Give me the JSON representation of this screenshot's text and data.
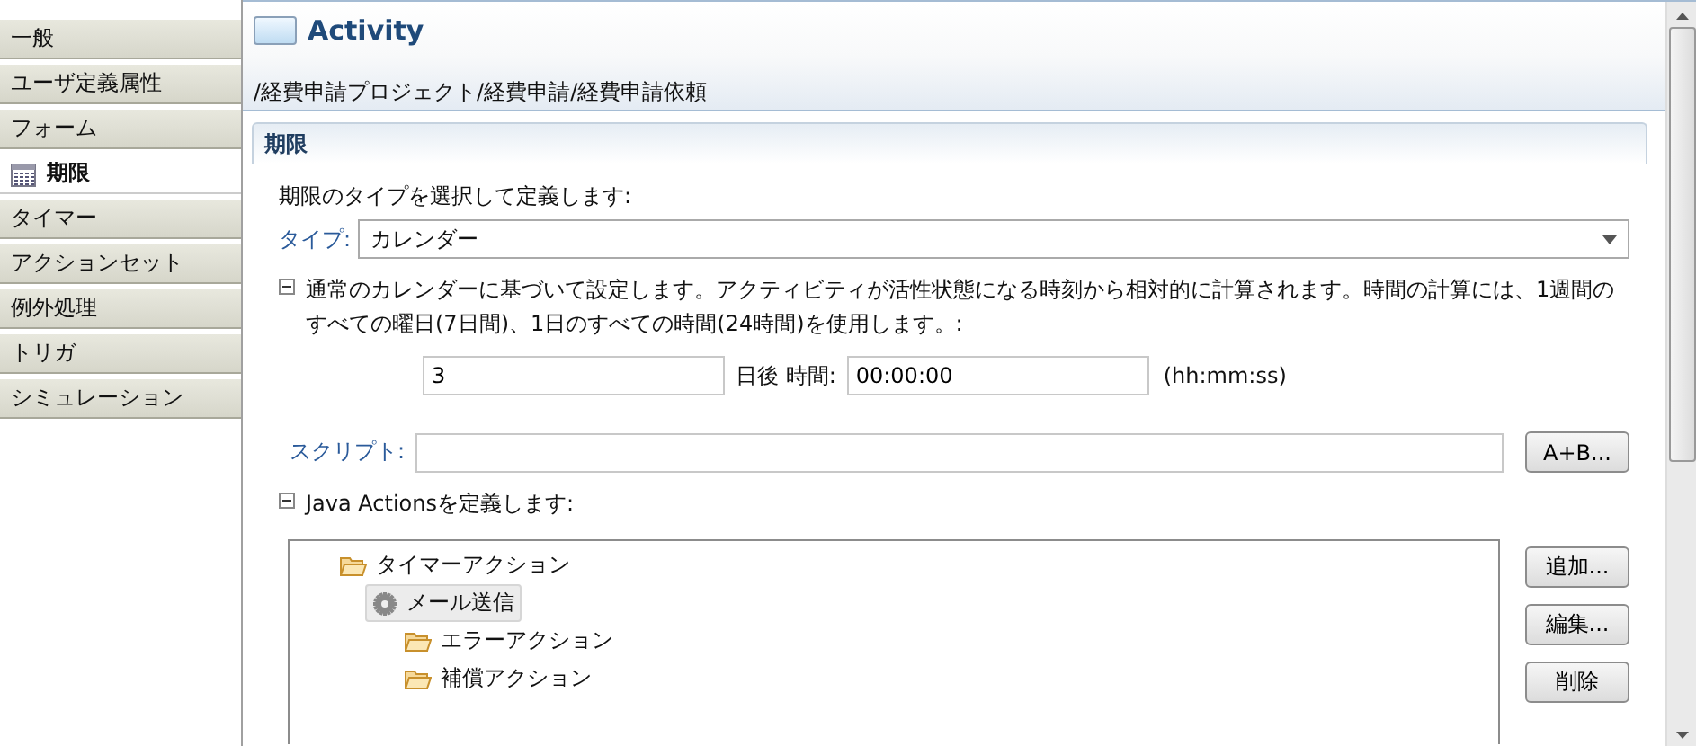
{
  "sidebar": {
    "items": [
      {
        "label": "一般",
        "selected": false
      },
      {
        "label": "ユーザ定義属性",
        "selected": false
      },
      {
        "label": "フォーム",
        "selected": false
      },
      {
        "label": "期限",
        "selected": true
      },
      {
        "label": "タイマー",
        "selected": false
      },
      {
        "label": "アクションセット",
        "selected": false
      },
      {
        "label": "例外処理",
        "selected": false
      },
      {
        "label": "トリガ",
        "selected": false
      },
      {
        "label": "シミュレーション",
        "selected": false
      }
    ]
  },
  "header": {
    "title": "Activity",
    "path": "/経費申請プロジェクト/経費申請/経費申請依頼"
  },
  "section": {
    "title": "期限",
    "intro": "期限のタイプを選択して定義します:",
    "type": {
      "label": "タイプ:",
      "value": "カレンダー"
    },
    "calendar": {
      "expanded": true,
      "description": "通常のカレンダーに基づいて設定します。アクティビティが活性状態になる時刻から相対的に計算されます。時間の計算には、1週間のすべての曜日(7日間)、1日のすべての時間(24時間)を使用します。:",
      "days": "3",
      "days_label": "日後 時間:",
      "time": "00:00:00",
      "time_format": "(hh:mm:ss)"
    },
    "script": {
      "label": "スクリプト:",
      "button": "A+B..."
    },
    "java_actions": {
      "expanded": true,
      "title": "Java Actionsを定義します:",
      "tree": [
        {
          "label": "タイマーアクション",
          "kind": "folder",
          "selected": false,
          "children": [
            {
              "label": "メール送信",
              "kind": "action",
              "selected": true,
              "children": [
                {
                  "label": "エラーアクション",
                  "kind": "folder",
                  "selected": false
                },
                {
                  "label": "補償アクション",
                  "kind": "folder",
                  "selected": false
                }
              ]
            }
          ]
        }
      ],
      "buttons": [
        "追加...",
        "編集...",
        "削除"
      ]
    }
  }
}
